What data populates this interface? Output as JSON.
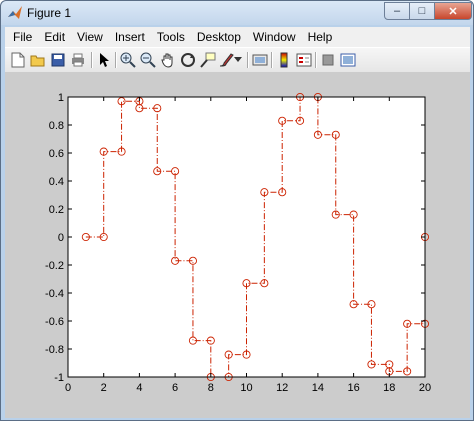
{
  "window": {
    "title": "Figure 1",
    "controls": {
      "minimize": "‒",
      "maximize": "□",
      "close": "✕"
    }
  },
  "menu": [
    "File",
    "Edit",
    "View",
    "Insert",
    "Tools",
    "Desktop",
    "Window",
    "Help"
  ],
  "toolbar": [
    "new-figure-icon",
    "open-file-icon",
    "save-icon",
    "print-icon",
    "edit-plot-arrow-icon",
    "zoom-in-icon",
    "zoom-out-icon",
    "pan-hand-icon",
    "rotate-3d-icon",
    "data-cursor-icon",
    "brush-icon",
    "brush-dropdown-icon",
    "link-plot-icon",
    "insert-colorbar-icon",
    "insert-legend-icon",
    "hide-plot-tools-icon",
    "show-plot-tools-icon"
  ],
  "colors": {
    "figure_bg": "#cccccc",
    "axes_bg": "#ffffff",
    "series": "#cc2200"
  },
  "chart_data": {
    "type": "line",
    "style": "stairs dash-dot with circle markers",
    "title": "",
    "xlabel": "",
    "ylabel": "",
    "xlim": [
      0,
      20
    ],
    "ylim": [
      -1,
      1
    ],
    "xticks": [
      "0",
      "2",
      "4",
      "6",
      "8",
      "10",
      "12",
      "14",
      "16",
      "18",
      "20"
    ],
    "yticks": [
      "1",
      "0.8",
      "0.6",
      "0.4",
      "0.2",
      "0",
      "-0.2",
      "-0.4",
      "-0.6",
      "-0.8",
      "-1"
    ],
    "grid": false,
    "series": [
      {
        "x": [
          1,
          2,
          3,
          4,
          5,
          6,
          7,
          8,
          9,
          10,
          11,
          12,
          13,
          14,
          15,
          16,
          17,
          18,
          19,
          20
        ],
        "y": [
          0,
          0.61,
          0.97,
          0.92,
          0.47,
          -0.17,
          -0.74,
          -1.0,
          -0.84,
          -0.33,
          0.32,
          0.83,
          1.0,
          0.73,
          0.16,
          -0.48,
          -0.91,
          -0.96,
          -0.62,
          0.0
        ]
      }
    ]
  }
}
